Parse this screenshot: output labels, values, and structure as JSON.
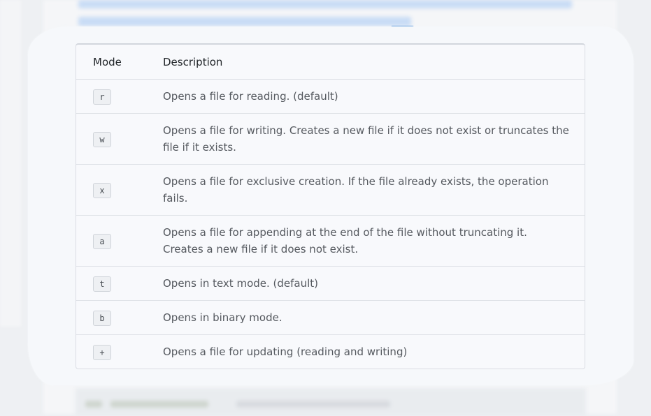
{
  "table": {
    "headers": {
      "mode": "Mode",
      "description": "Description"
    },
    "rows": [
      {
        "mode": "r",
        "description": "Opens a file for reading. (default)"
      },
      {
        "mode": "w",
        "description": "Opens a file for writing. Creates a new file if it does not exist or truncates the file if it exists."
      },
      {
        "mode": "x",
        "description": "Opens a file for exclusive creation. If the file already exists, the operation fails."
      },
      {
        "mode": "a",
        "description": "Opens a file for appending at the end of the file without truncating it. Creates a new file if it does not exist."
      },
      {
        "mode": "t",
        "description": "Opens in text mode. (default)"
      },
      {
        "mode": "b",
        "description": "Opens in binary mode."
      },
      {
        "mode": "+",
        "description": "Opens a file for updating (reading and writing)"
      }
    ]
  }
}
